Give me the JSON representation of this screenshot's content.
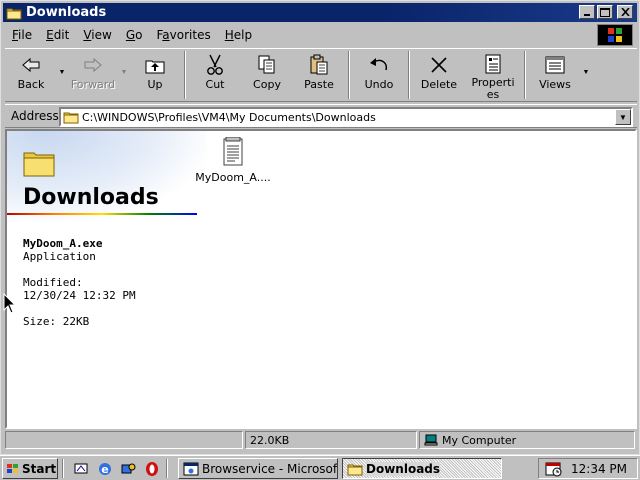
{
  "window": {
    "title": "Downloads"
  },
  "menubar": {
    "items": [
      "File",
      "Edit",
      "View",
      "Go",
      "Favorites",
      "Help"
    ],
    "underline": [
      "F",
      "E",
      "V",
      "G",
      "a",
      "H"
    ]
  },
  "toolbar": {
    "back": "Back",
    "forward": "Forward",
    "up": "Up",
    "cut": "Cut",
    "copy": "Copy",
    "paste": "Paste",
    "undo": "Undo",
    "delete": "Delete",
    "properties": "Properties",
    "views": "Views"
  },
  "address": {
    "label": "Address",
    "value": "C:\\WINDOWS\\Profiles\\VM4\\My Documents\\Downloads"
  },
  "webview": {
    "title": "Downloads",
    "file_name": "MyDoom_A.exe",
    "file_type": "Application",
    "modified_label": "Modified:",
    "modified_value": "12/30/24 12:32 PM",
    "size": "Size: 22KB"
  },
  "files": [
    {
      "label": "MyDoom_A....",
      "icon": "exe-document-icon"
    }
  ],
  "statusbar": {
    "left": "",
    "size": "22.0KB",
    "zone": "My Computer"
  },
  "taskbar": {
    "start_label": "Start",
    "tasks": [
      {
        "label": "Browservice - Microsof...",
        "active": false
      },
      {
        "label": "Downloads",
        "active": true
      }
    ],
    "clock": "12:34 PM"
  },
  "colors": {
    "titlebar": "#0a246a",
    "face": "#c0c0c0",
    "window_bg": "#ffffff"
  }
}
